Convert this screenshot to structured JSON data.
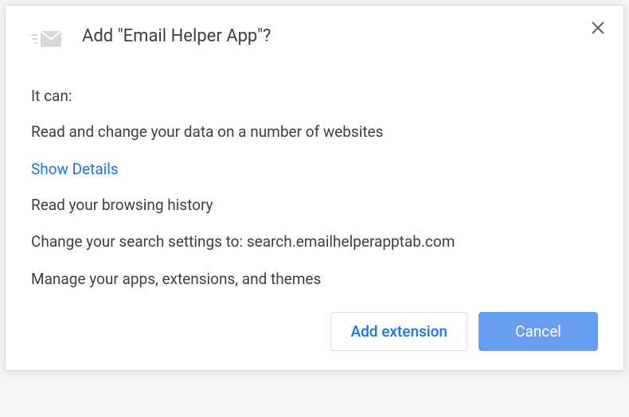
{
  "dialog": {
    "title": "Add \"Email Helper App\"?",
    "permissions_label": "It can:",
    "permissions": {
      "p1": "Read and change your data on a number of websites",
      "p2": "Read your browsing history",
      "p3": "Change your search settings to: search.emailhelperapptab.com",
      "p4": "Manage your apps, extensions, and themes"
    },
    "details_link": "Show Details",
    "buttons": {
      "add": "Add extension",
      "cancel": "Cancel"
    }
  }
}
